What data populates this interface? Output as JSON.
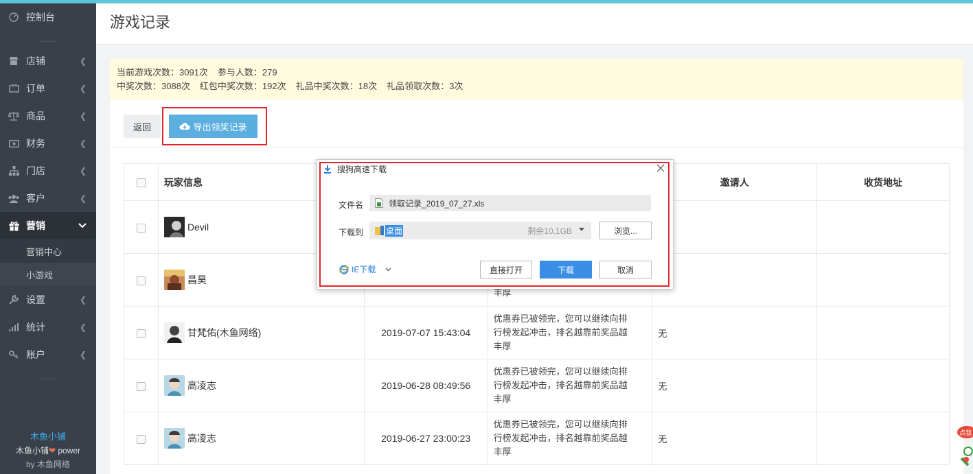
{
  "sidebar": {
    "items": [
      {
        "label": "控制台",
        "icon": "dashboard-icon"
      },
      {
        "label": "店铺",
        "icon": "shop-icon"
      },
      {
        "label": "订单",
        "icon": "order-icon"
      },
      {
        "label": "商品",
        "icon": "scale-icon"
      },
      {
        "label": "财务",
        "icon": "finance-icon"
      },
      {
        "label": "门店",
        "icon": "store-icon"
      },
      {
        "label": "客户",
        "icon": "customer-icon"
      },
      {
        "label": "营销",
        "icon": "gift-icon"
      },
      {
        "label": "设置",
        "icon": "wrench-icon"
      },
      {
        "label": "统计",
        "icon": "bar-chart-icon"
      },
      {
        "label": "账户",
        "icon": "key-icon"
      }
    ],
    "sub_items": [
      {
        "label": "营销中心"
      },
      {
        "label": "小游戏"
      }
    ],
    "dots": "……",
    "brand_name": "木鱼小铺",
    "brand_power_prefix": "木鱼小铺",
    "brand_power_suffix": " power",
    "brand_by": "by 木鱼网络"
  },
  "header": {
    "title": "游戏记录"
  },
  "stats": {
    "line1": [
      "当前游戏次数：3091次",
      "参与人数：279"
    ],
    "line2": [
      "中奖次数：3088次",
      "红包中奖次数：192次",
      "礼品中奖次数：18次",
      "礼品领取次数：3次"
    ]
  },
  "toolbar": {
    "back_label": "返回",
    "export_label": "导出领奖记录"
  },
  "table": {
    "headers": {
      "player": "玩家信息",
      "inviter": "邀请人",
      "address": "收货地址"
    },
    "rows": [
      {
        "name": "Devil",
        "time": "",
        "prize_lines": [],
        "inviter": ""
      },
      {
        "name": "昌昊",
        "time": "",
        "prize_lines": [
          "",
          "",
          "丰厚"
        ],
        "inviter": ""
      },
      {
        "name": "甘梵佑(木鱼网络)",
        "time": "2019-07-07 15:43:04",
        "prize_lines": [
          "优惠券已被领完，您可以继续向排",
          "行榜发起冲击，排名越靠前奖品越",
          "丰厚"
        ],
        "inviter": "无"
      },
      {
        "name": "高凌志",
        "time": "2019-06-28 08:49:56",
        "prize_lines": [
          "优惠券已被领完，您可以继续向排",
          "行榜发起冲击，排名越靠前奖品越",
          "丰厚"
        ],
        "inviter": "无"
      },
      {
        "name": "高凌志",
        "time": "2019-06-27 23:00:23",
        "prize_lines": [
          "优惠券已被领完，您可以继续向排",
          "行榜发起冲击，排名越靠前奖品越",
          "丰厚"
        ],
        "inviter": "无"
      }
    ]
  },
  "dialog": {
    "title": "搜狗高速下载",
    "file_label": "文件名",
    "file_name": "领取记录_2019_07_27.xls",
    "dest_label": "下载到",
    "dest_value": "桌面",
    "free_space": "剩余10.1GB",
    "browse_label": "浏览...",
    "ie_label": "IE下载",
    "open_label": "直接打开",
    "download_label": "下载",
    "cancel_label": "取消"
  },
  "float_widget": {
    "label": "点我"
  },
  "colors": {
    "accent": "#5aafe0",
    "highlight": "#e0262c",
    "sidebar": "#3a4049",
    "topbar": "#5bc5d9"
  }
}
